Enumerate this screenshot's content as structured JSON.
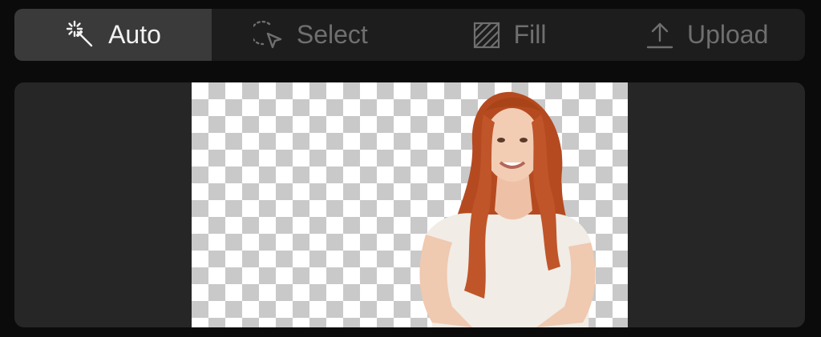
{
  "toolbar": {
    "tabs": [
      {
        "label": "Auto",
        "icon": "magic-wand-icon",
        "active": true
      },
      {
        "label": "Select",
        "icon": "lasso-select-icon",
        "active": false
      },
      {
        "label": "Fill",
        "icon": "fill-pattern-icon",
        "active": false
      },
      {
        "label": "Upload",
        "icon": "upload-icon",
        "active": false
      }
    ]
  },
  "canvas": {
    "background": "transparent-checkerboard",
    "subject": "portrait-cutout"
  },
  "colors": {
    "page_bg": "#0b0b0b",
    "toolbar_bg": "#1d1d1d",
    "active_tab_bg": "#3a3a3a",
    "active_text": "#f2f2f2",
    "inactive_text": "#6f6f6f",
    "panel_bg": "#262626"
  }
}
